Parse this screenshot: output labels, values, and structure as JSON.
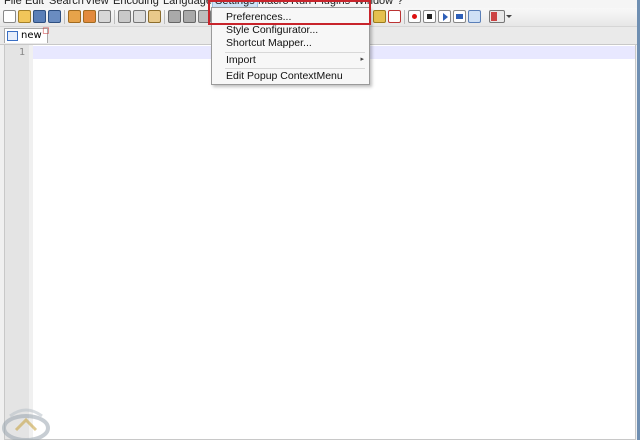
{
  "menubar": {
    "items": [
      "File",
      "Edit",
      "Search",
      "View",
      "Encoding",
      "Language",
      "Settings",
      "Macro",
      "Run",
      "Plugins",
      "Window",
      "?"
    ]
  },
  "tab": {
    "label": "new"
  },
  "editor": {
    "line_number": "1"
  },
  "dropdown": {
    "items": [
      {
        "label": "Preferences..."
      },
      {
        "label": "Style Configurator..."
      },
      {
        "label": "Shortcut Mapper..."
      },
      {
        "label": "Import"
      },
      {
        "label": "Edit Popup ContextMenu"
      }
    ]
  },
  "colors": {
    "highlight": "#c8242b",
    "accent": "#3a6fc4"
  }
}
